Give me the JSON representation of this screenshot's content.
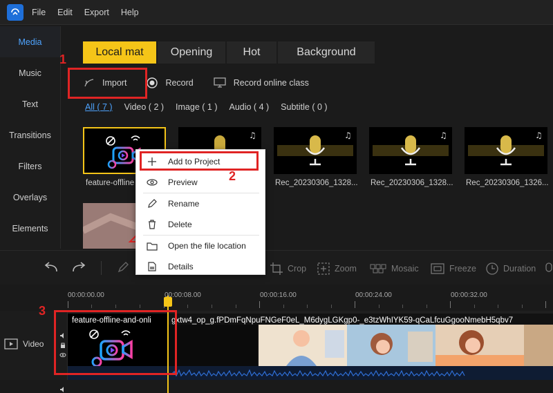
{
  "menu": {
    "items": [
      "File",
      "Edit",
      "Export",
      "Help"
    ]
  },
  "nav": {
    "items": [
      "Media",
      "Music",
      "Text",
      "Transitions",
      "Filters",
      "Overlays",
      "Elements"
    ],
    "active": "Media"
  },
  "tabs": {
    "items": [
      "Local mat",
      "Opening",
      "Hot",
      "Background"
    ],
    "active": "Local mat"
  },
  "actions": {
    "import": "Import",
    "record": "Record",
    "record_online": "Record online class"
  },
  "filters": {
    "all": "All ( 7 )",
    "video": "Video ( 2 )",
    "image": "Image ( 1 )",
    "audio": "Audio ( 4 )",
    "subtitle": "Subtitle ( 0 )"
  },
  "media": {
    "items": [
      {
        "label": "feature-offline",
        "kind": "video"
      },
      {
        "label": "",
        "kind": "audio"
      },
      {
        "label": "Rec_20230306_1328...",
        "kind": "audio"
      },
      {
        "label": "Rec_20230306_1328...",
        "kind": "audio"
      },
      {
        "label": "Rec_20230306_1326...",
        "kind": "audio"
      }
    ]
  },
  "context_menu": {
    "add": "Add to Project",
    "preview": "Preview",
    "rename": "Rename",
    "delete": "Delete",
    "open_location": "Open the file location",
    "details": "Details"
  },
  "toolbar": {
    "crop": "Crop",
    "zoom": "Zoom",
    "mosaic": "Mosaic",
    "freeze": "Freeze",
    "duration": "Duration"
  },
  "timeline": {
    "ticks": [
      "00:00:00.00",
      "00:00:08.00",
      "00:00:16.00",
      "00:00:24.00",
      "00:00:32.00"
    ],
    "track_label": "Video",
    "clip1_title": "feature-offline-and-onli",
    "clip2_title": "gxtw4_op_g.fPDmFqNpuFNGeF0eL_M6dygLGKgp0-_e3tzWhIYK59-qCaLfcuGgooNmebH5qbv7"
  },
  "annotations": {
    "n1": "1",
    "n2": "2",
    "n3": "3"
  },
  "colors": {
    "accent": "#4ea4ff",
    "tab_active": "#f5c518",
    "annotation": "#e02424"
  }
}
